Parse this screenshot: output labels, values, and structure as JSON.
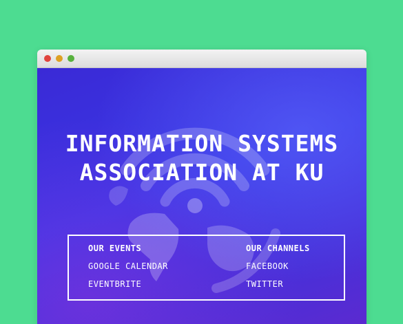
{
  "window": {
    "controls": {
      "close": "#e0443e",
      "minimize": "#dea123",
      "maximize": "#58b13d"
    }
  },
  "hero": {
    "title_line1": "INFORMATION SYSTEMS",
    "title_line2": "ASSOCIATION AT KU",
    "background_icon": "globe-wifi-icon"
  },
  "links": {
    "events": {
      "heading": "OUR EVENTS",
      "items": [
        "GOOGLE CALENDAR",
        "EVENTBRITE"
      ]
    },
    "channels": {
      "heading": "OUR CHANNELS",
      "items": [
        "FACEBOOK",
        "TWITTER"
      ]
    }
  },
  "colors": {
    "page_background": "#4ddc91",
    "hero_primary": "#3b37e6",
    "hero_text": "#ffffff"
  }
}
